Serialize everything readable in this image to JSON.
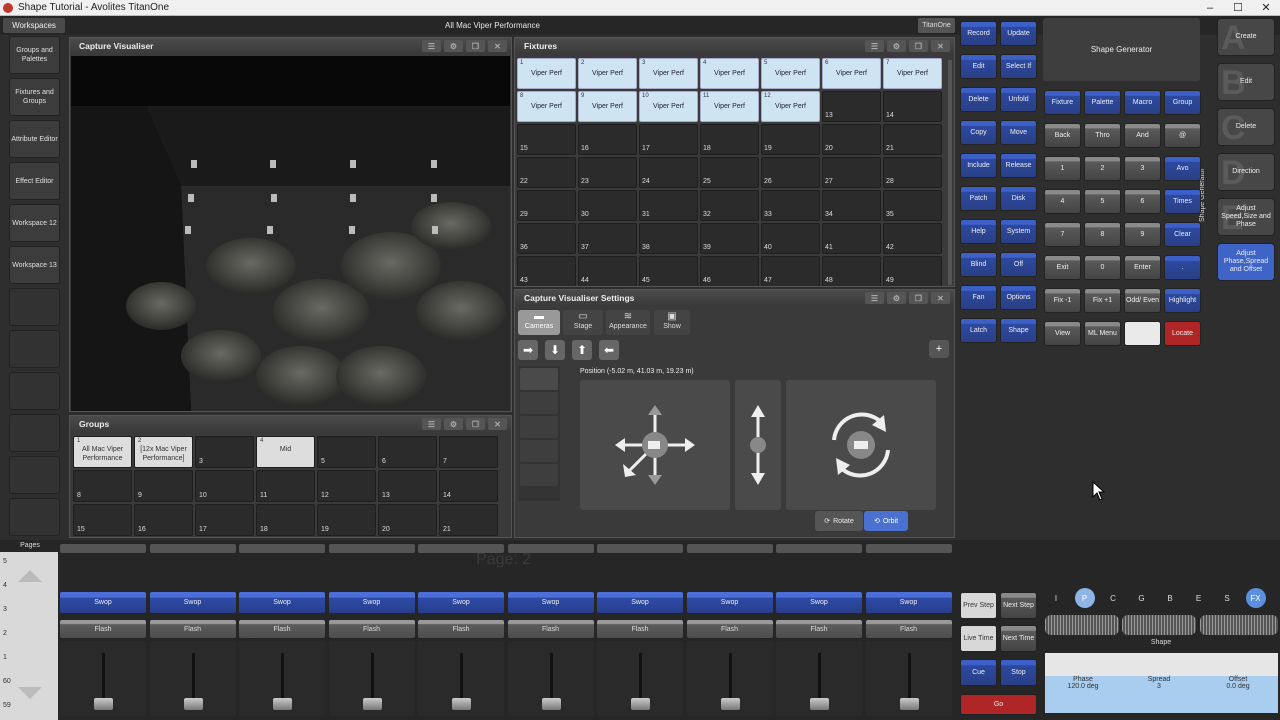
{
  "window": {
    "title": "Shape Tutorial - Avolites TitanOne",
    "minimize": "–",
    "maximize": "☐",
    "close": "✕"
  },
  "top": {
    "workspaces": "Workspaces",
    "center_title": "All Mac Viper Performance",
    "titanone": "TitanOne"
  },
  "workspaces": [
    "Groups and Palettes",
    "Fixtures and Groups",
    "Attribute Editor",
    "Effect Editor",
    "Workspace 12",
    "Workspace 13"
  ],
  "capture": {
    "title": "Capture Visualiser"
  },
  "fixtures": {
    "title": "Fixtures",
    "items": [
      {
        "num": "1",
        "label": "Viper Perf"
      },
      {
        "num": "2",
        "label": "Viper Perf"
      },
      {
        "num": "3",
        "label": "Viper Perf"
      },
      {
        "num": "4",
        "label": "Viper Perf"
      },
      {
        "num": "5",
        "label": "Viper Perf"
      },
      {
        "num": "6",
        "label": "Viper Perf"
      },
      {
        "num": "7",
        "label": "Viper Perf"
      },
      {
        "num": "8",
        "label": "Viper Perf"
      },
      {
        "num": "9",
        "label": "Viper Perf"
      },
      {
        "num": "10",
        "label": "Viper Perf"
      },
      {
        "num": "11",
        "label": "Viper Perf"
      },
      {
        "num": "12",
        "label": "Viper Perf"
      },
      {
        "num": "13",
        "label": ""
      },
      {
        "num": "14",
        "label": ""
      },
      {
        "num": "15",
        "label": ""
      },
      {
        "num": "16",
        "label": ""
      },
      {
        "num": "17",
        "label": ""
      },
      {
        "num": "18",
        "label": ""
      },
      {
        "num": "19",
        "label": ""
      },
      {
        "num": "20",
        "label": ""
      },
      {
        "num": "21",
        "label": ""
      },
      {
        "num": "22",
        "label": ""
      },
      {
        "num": "23",
        "label": ""
      },
      {
        "num": "24",
        "label": ""
      },
      {
        "num": "25",
        "label": ""
      },
      {
        "num": "26",
        "label": ""
      },
      {
        "num": "27",
        "label": ""
      },
      {
        "num": "28",
        "label": ""
      },
      {
        "num": "29",
        "label": ""
      },
      {
        "num": "30",
        "label": ""
      },
      {
        "num": "31",
        "label": ""
      },
      {
        "num": "32",
        "label": ""
      },
      {
        "num": "33",
        "label": ""
      },
      {
        "num": "34",
        "label": ""
      },
      {
        "num": "35",
        "label": ""
      },
      {
        "num": "36",
        "label": ""
      },
      {
        "num": "37",
        "label": ""
      },
      {
        "num": "38",
        "label": ""
      },
      {
        "num": "39",
        "label": ""
      },
      {
        "num": "40",
        "label": ""
      },
      {
        "num": "41",
        "label": ""
      },
      {
        "num": "42",
        "label": ""
      },
      {
        "num": "43",
        "label": ""
      },
      {
        "num": "44",
        "label": ""
      },
      {
        "num": "45",
        "label": ""
      },
      {
        "num": "46",
        "label": ""
      },
      {
        "num": "47",
        "label": ""
      },
      {
        "num": "48",
        "label": ""
      },
      {
        "num": "49",
        "label": ""
      }
    ]
  },
  "groups": {
    "title": "Groups",
    "items": [
      {
        "num": "1",
        "label": "All Mac Viper Performance",
        "on": true
      },
      {
        "num": "2",
        "label": "[12x Mac Viper Performance]",
        "on": true
      },
      {
        "num": "3",
        "label": "",
        "on": false
      },
      {
        "num": "4",
        "label": "Mid",
        "on": true
      },
      {
        "num": "5",
        "label": "",
        "on": false
      },
      {
        "num": "6",
        "label": "",
        "on": false
      },
      {
        "num": "7",
        "label": "",
        "on": false
      },
      {
        "num": "8",
        "label": "",
        "on": false
      },
      {
        "num": "9",
        "label": "",
        "on": false
      },
      {
        "num": "10",
        "label": "",
        "on": false
      },
      {
        "num": "11",
        "label": "",
        "on": false
      },
      {
        "num": "12",
        "label": "",
        "on": false
      },
      {
        "num": "13",
        "label": "",
        "on": false
      },
      {
        "num": "14",
        "label": "",
        "on": false
      },
      {
        "num": "15",
        "label": "",
        "on": false
      },
      {
        "num": "16",
        "label": "",
        "on": false
      },
      {
        "num": "17",
        "label": "",
        "on": false
      },
      {
        "num": "18",
        "label": "",
        "on": false
      },
      {
        "num": "19",
        "label": "",
        "on": false
      },
      {
        "num": "20",
        "label": "",
        "on": false
      },
      {
        "num": "21",
        "label": "",
        "on": false
      }
    ]
  },
  "settings": {
    "title": "Capture Visualiser Settings",
    "tabs": [
      "Cameras",
      "Stage",
      "Appearance",
      "Show"
    ],
    "position": "Position (-5.02 m, 41.03 m, 19.23 m)",
    "rotate": "Rotate",
    "orbit": "Orbit",
    "plus": "+"
  },
  "keys": {
    "left": [
      [
        "Record",
        "Update"
      ],
      [
        "Edit",
        "Select If"
      ],
      [
        "Delete",
        "Unfold"
      ],
      [
        "Copy",
        "Move"
      ],
      [
        "Include",
        "Release"
      ],
      [
        "Patch",
        "Disk"
      ],
      [
        "Help",
        "System"
      ],
      [
        "Blind",
        "Off"
      ],
      [
        "Fan",
        "Options"
      ],
      [
        "Latch",
        "Shape"
      ]
    ],
    "shape_generator": "Shape Generator",
    "side_label": "Shape Generator",
    "row1": [
      "Fixture",
      "Palette",
      "Macro",
      "Group"
    ],
    "row2": [
      "Back",
      "Thro",
      "And",
      "@"
    ],
    "numpad": [
      [
        "1",
        "2",
        "3",
        "Avo"
      ],
      [
        "4",
        "5",
        "6",
        "Times"
      ],
      [
        "7",
        "8",
        "9",
        "Clear"
      ],
      [
        "Exit",
        "0",
        "Enter",
        "."
      ],
      [
        "Fix -1",
        "Fix +1",
        "Odd/ Even",
        "Highlight"
      ],
      [
        "View",
        "ML Menu",
        "",
        "Locate"
      ]
    ]
  },
  "right_buttons": [
    {
      "letter": "A",
      "label": "Create"
    },
    {
      "letter": "B",
      "label": "Edit"
    },
    {
      "letter": "C",
      "label": "Delete"
    },
    {
      "letter": "D",
      "label": "Direction"
    },
    {
      "letter": "E",
      "label": "Adjust Speed,Size and Phase"
    },
    {
      "letter": "",
      "label": "Adjust Phase,Spread and Offset"
    }
  ],
  "playback": {
    "pages_label": "Pages",
    "page_numbers": [
      "5",
      "4",
      "3",
      "2",
      "1",
      "60",
      "59"
    ],
    "page_watermark": "Page: 2",
    "swop": "Swop",
    "flash": "Flash"
  },
  "transport": {
    "prev_step": "Prev Step",
    "next_step": "Next Step",
    "live_time": "Live Time",
    "next_time": "Next Time",
    "cue": "Cue",
    "stop": "Stop",
    "go": "Go"
  },
  "attributes": {
    "tabs": [
      "I",
      "P",
      "C",
      "G",
      "B",
      "E",
      "S",
      "FX"
    ],
    "wheel_label": "Shape",
    "values": [
      {
        "name": "Phase",
        "value": "120.0 deg"
      },
      {
        "name": "Spread",
        "value": "3"
      },
      {
        "name": "Offset",
        "value": "0.0 deg"
      }
    ]
  }
}
